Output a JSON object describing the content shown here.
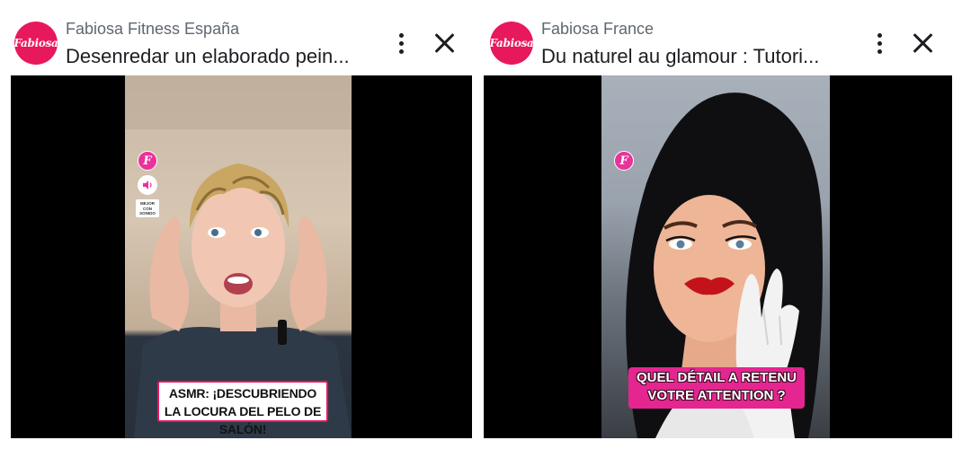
{
  "cards": [
    {
      "avatar_text": "Fabiosa",
      "page_name": "Fabiosa Fitness España",
      "title": "Desenredar un elaborado pein...",
      "video": {
        "badge_letter": "F",
        "sound_label_lines": [
          "MEJOR",
          "CON",
          "SONIDO"
        ],
        "caption_lines": [
          "ASMR: ¡DESCUBRIENDO",
          "LA LOCURA DEL PELO DE SALÓN!"
        ]
      }
    },
    {
      "avatar_text": "Fabiosa",
      "page_name": "Fabiosa France",
      "title": "Du naturel au glamour : Tutori...",
      "video": {
        "badge_letter": "F",
        "caption_lines": [
          "QUEL DÉTAIL A RETENU",
          "VOTRE ATTENTION ?"
        ]
      }
    }
  ],
  "icons": {
    "more": "more-vertical-icon",
    "close": "close-icon",
    "sound": "speaker-icon"
  },
  "colors": {
    "brand": "#e8185c",
    "badge": "#e8339a",
    "caption_pink": "#e52590"
  }
}
